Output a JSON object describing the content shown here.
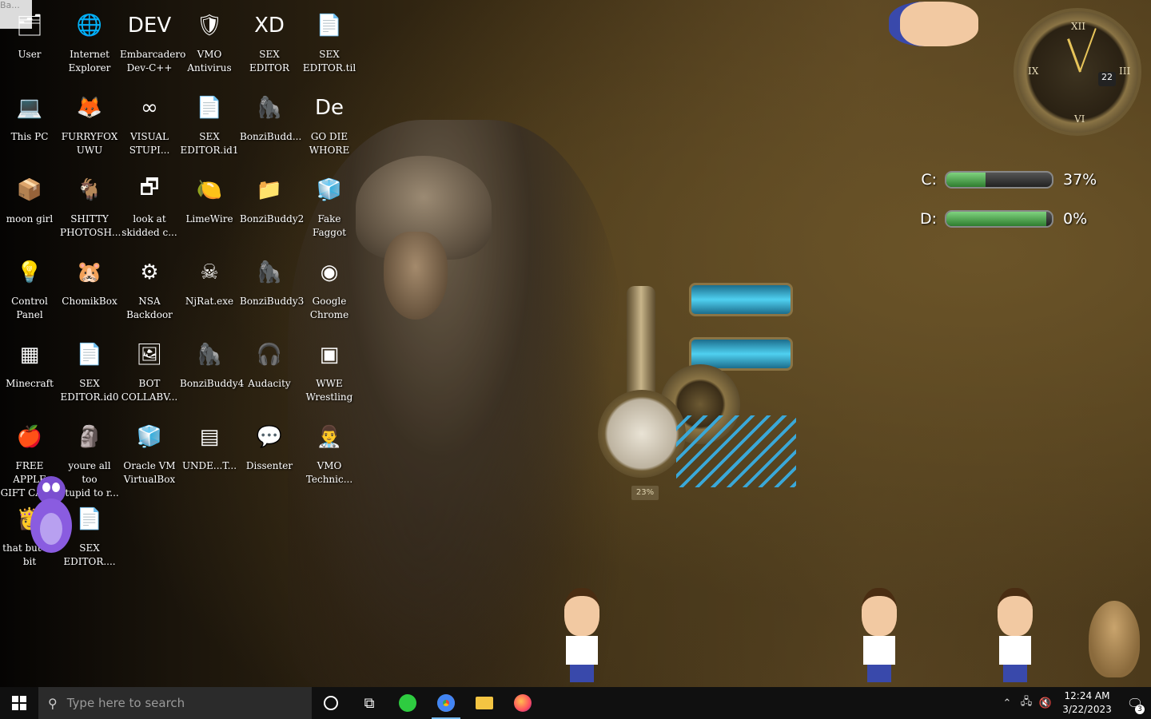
{
  "desktop_icons": [
    {
      "label": "User",
      "glyph": "🗂"
    },
    {
      "label": "Internet\nExplorer",
      "glyph": "🌐"
    },
    {
      "label": "Embarcadero\nDev-C++",
      "glyph": "DEV"
    },
    {
      "label": "VMO\nAntivirus",
      "glyph": "🛡"
    },
    {
      "label": "SEX\nEDITOR",
      "glyph": "XD"
    },
    {
      "label": "SEX\nEDITOR.til",
      "glyph": "📄"
    },
    {
      "label": "This PC",
      "glyph": "💻"
    },
    {
      "label": "FURRYFOX\nUWU",
      "glyph": "🦊"
    },
    {
      "label": "VISUAL\nSTUPI...",
      "glyph": "∞"
    },
    {
      "label": "SEX\nEDITOR.id1",
      "glyph": "📄"
    },
    {
      "label": "BonziBudd...",
      "glyph": "🦍"
    },
    {
      "label": "GO DIE\nWHORE",
      "glyph": "De"
    },
    {
      "label": "moon girl",
      "glyph": "📦"
    },
    {
      "label": "SHITTY\nPHOTOSH...",
      "glyph": "🐐"
    },
    {
      "label": "look at\nskidded c...",
      "glyph": "🗗"
    },
    {
      "label": "LimeWire",
      "glyph": "🍋"
    },
    {
      "label": "BonziBuddy2",
      "glyph": "📁"
    },
    {
      "label": "Fake Faggot",
      "glyph": "🧊"
    },
    {
      "label": "Control\nPanel",
      "glyph": "💡"
    },
    {
      "label": "ChomikBox",
      "glyph": "🐹"
    },
    {
      "label": "NSA\nBackdoor",
      "glyph": "⚙"
    },
    {
      "label": "NjRat.exe",
      "glyph": "☠"
    },
    {
      "label": "BonziBuddy3",
      "glyph": "🦍"
    },
    {
      "label": "Google\nChrome",
      "glyph": "◉"
    },
    {
      "label": "Minecraft",
      "glyph": "▦"
    },
    {
      "label": "SEX\nEDITOR.id0",
      "glyph": "📄"
    },
    {
      "label": "BOT\nCOLLABV...",
      "glyph": "🖼"
    },
    {
      "label": "BonziBuddy4",
      "glyph": "🦍"
    },
    {
      "label": "Audacity",
      "glyph": "🎧"
    },
    {
      "label": "WWE\nWrestling",
      "glyph": "▣"
    },
    {
      "label": "FREE APPLE\nGIFT CAR...",
      "glyph": "🍎"
    },
    {
      "label": "youre all too\nstupid to r...",
      "glyph": "🗿"
    },
    {
      "label": "Oracle VM\nVirtualBox",
      "glyph": "🧊"
    },
    {
      "label": "UNDE...T...",
      "glyph": "▤"
    },
    {
      "label": "Dissenter",
      "glyph": "💬"
    },
    {
      "label": "VMO\nTechnic...",
      "glyph": "👨‍⚕️"
    },
    {
      "label": "that but 32\nbit",
      "glyph": "👸"
    },
    {
      "label": "SEX\nEDITOR....",
      "glyph": "📄"
    }
  ],
  "top_box_text": "Ba...",
  "drives": [
    {
      "letter": "C:",
      "percent": "37%",
      "fill": 0.37
    },
    {
      "letter": "D:",
      "percent": "0%",
      "fill": 0.95
    }
  ],
  "clock_widget": {
    "numerals": [
      "XII",
      "III",
      "VI",
      "IX"
    ],
    "date": "22"
  },
  "gauge_readout": "23%",
  "taskbar": {
    "search_placeholder": "Type here to search",
    "time": "12:24 AM",
    "date": "3/22/2023",
    "notification_count": "3"
  },
  "accent_color": "#76b9ed"
}
